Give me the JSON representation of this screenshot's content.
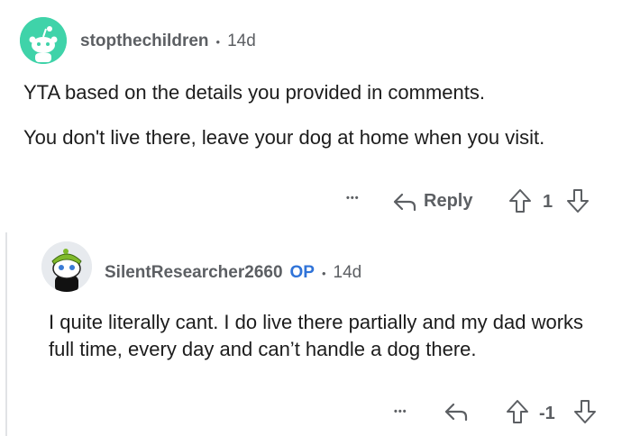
{
  "comments": [
    {
      "username": "stopthechildren",
      "separator": "•",
      "age": "14d",
      "paragraphs": [
        "YTA based on the details you provided in comments.",
        "You don't live there, leave your dog at home when you visit."
      ],
      "more_label": "•••",
      "reply_label": "Reply",
      "score": "1"
    },
    {
      "username": "SilentResearcher2660",
      "op_badge": "OP",
      "separator": "•",
      "age": "14d",
      "paragraphs": [
        "I quite literally cant. I do live there partially and my dad works full time, every day and can’t handle a dog there."
      ],
      "more_label": "•••",
      "score": "-1"
    }
  ],
  "colors": {
    "avatar1_bg": "#3fd3a9",
    "avatar2_bg": "#e7eaee",
    "meta_text": "#5c5f63",
    "op_badge": "#2f73d8",
    "thread_line": "#e1e3e6"
  }
}
